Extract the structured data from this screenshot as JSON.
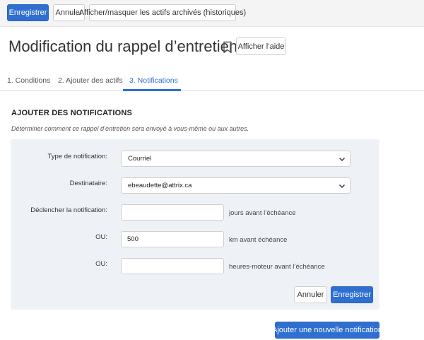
{
  "toolbar": {
    "save_label": "Enregistrer",
    "cancel_label": "Annuler",
    "toggle_archived_label": "Afficher/masquer les actifs archivés (historiques)"
  },
  "page": {
    "title": "Modification du rappel d’entretien",
    "help_label": "Afficher l’aide"
  },
  "tabs": [
    {
      "label": "1. Conditions",
      "active": false
    },
    {
      "label": "2. Ajouter des actifs",
      "active": false
    },
    {
      "label": "3. Notifications",
      "active": true
    }
  ],
  "section": {
    "title": "AJOUTER DES NOTIFICATIONS",
    "subtitle": "Déterminer comment ce rappel d’entretien sera envoyé à vous-même ou aux autres."
  },
  "form": {
    "type_label": "Type de notification:",
    "type_value": "Courriel",
    "recipient_label": "Destinataire:",
    "recipient_value": "ebeaudette@attrix.ca",
    "trigger_label": "Déclencher la notification:",
    "trigger_value": "",
    "trigger_unit": "jours avant l’échéance",
    "or_label": "OU:",
    "km_value": "500",
    "km_unit": "km avant échéance",
    "hours_value": "",
    "hours_unit": "heures-moteur avant l’échéance",
    "cancel_label": "Annuler",
    "save_label": "Enregistrer"
  },
  "add_notification_label": "Ajouter une nouvelle notification",
  "colors": {
    "primary": "#2f6fd0",
    "panel_bg": "#eef1f6",
    "topbar_bg": "#f4f4f4"
  }
}
